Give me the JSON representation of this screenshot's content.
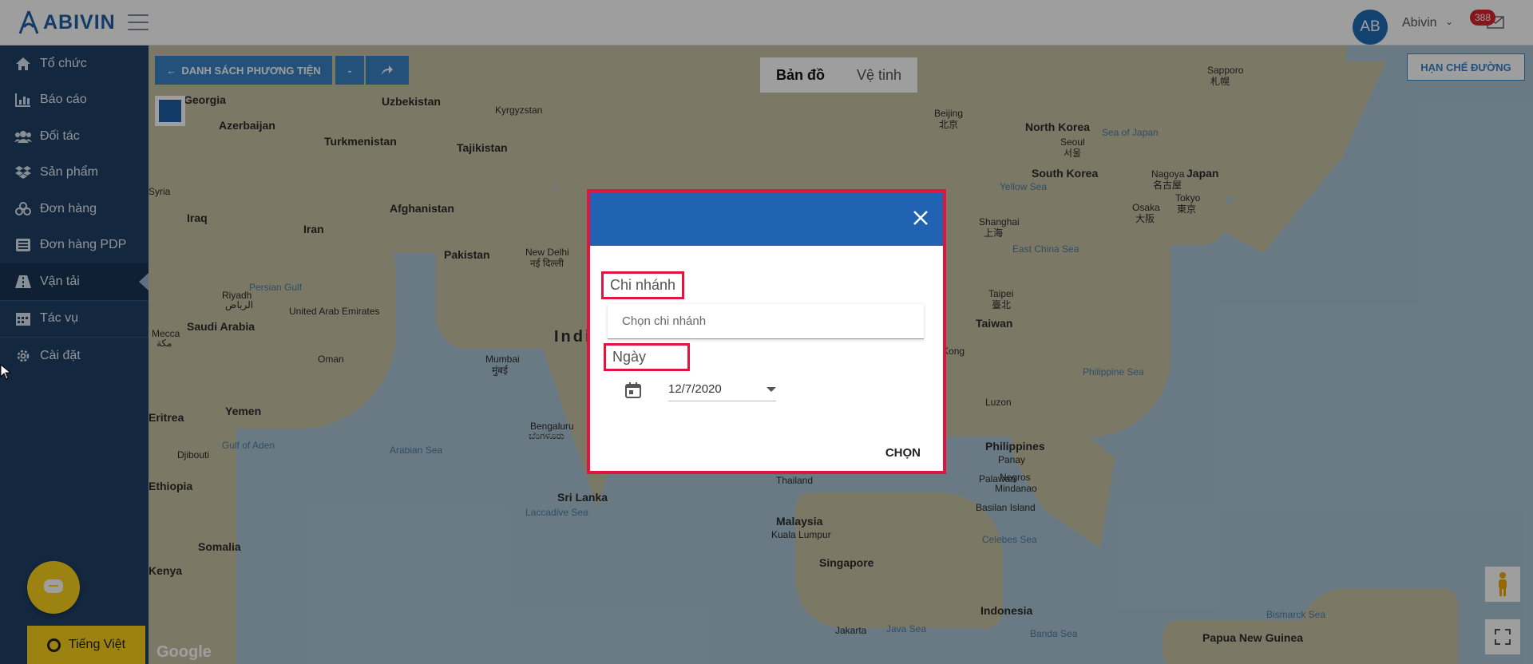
{
  "header": {
    "logo_text": "ABIVIN",
    "avatar_initials": "AB",
    "user_name": "Abivin",
    "notification_count": "388"
  },
  "sidebar": {
    "items": [
      {
        "label": "Tổ chức",
        "icon": "home-icon"
      },
      {
        "label": "Báo cáo",
        "icon": "bar-chart-icon"
      },
      {
        "label": "Đối tác",
        "icon": "users-icon"
      },
      {
        "label": "Sản phẩm",
        "icon": "dropbox-icon"
      },
      {
        "label": "Đơn hàng",
        "icon": "cubes-icon"
      },
      {
        "label": "Đơn hàng PDP",
        "icon": "list-icon"
      },
      {
        "label": "Vận tải",
        "icon": "road-icon",
        "active": true
      },
      {
        "label": "Tác vụ",
        "icon": "calendar-icon"
      },
      {
        "label": "Cài đặt",
        "icon": "gear-icon"
      }
    ],
    "language_label": "Tiếng Việt"
  },
  "map_controls": {
    "vehicle_list_label": "DANH SÁCH PHƯƠNG TIỆN",
    "minus_label": "-",
    "map_tab": "Bản đồ",
    "satellite_tab": "Vệ tinh",
    "restrict_roads_label": "HẠN CHẾ ĐƯỜNG",
    "google_label": "Google"
  },
  "map_labels": [
    "Georgia",
    "Uzbekistan",
    "Kyrgyzstan",
    "Azerbaijan",
    "Turkmenistan",
    "Tajikistan",
    "Syria",
    "Iraq",
    "Afghanistan",
    "Iran",
    "Pakistan",
    "New Delhi",
    "नई दिल्ली",
    "Persian Gulf",
    "Riyadh",
    "الرياض",
    "Saudi Arabia",
    "United Arab Emirates",
    "Mecca",
    "مكة",
    "Oman",
    "Mumbai",
    "मुंबई",
    "India",
    "Yemen",
    "Gulf of Aden",
    "Arabian Sea",
    "Djibouti",
    "Eritrea",
    "Ethiopia",
    "Somalia",
    "Kenya",
    "Bengaluru",
    "ಬೆಂಗಳೂರು",
    "Sri Lanka",
    "Laccadive Sea",
    "Beijing",
    "北京",
    "North Korea",
    "Sea of Japan",
    "Seoul",
    "서울",
    "South Korea",
    "Yellow Sea",
    "Nagoya",
    "名古屋",
    "Japan",
    "Osaka",
    "大阪",
    "Tokyo",
    "東京",
    "Sapporo",
    "札幌",
    "Shanghai",
    "上海",
    "East China Sea",
    "Taipei",
    "臺北",
    "Taiwan",
    "Hong Kong",
    "Philippine Sea",
    "Luzon",
    "Philippines",
    "Panay",
    "Palawan",
    "Negros",
    "Mindanao",
    "Basilan Island",
    "Celebes Sea",
    "Malaysia",
    "Kuala Lumpur",
    "Singapore",
    "Indonesia",
    "Jakarta",
    "Java Sea",
    "Banda Sea",
    "Bismarck Sea",
    "Papua New Guinea",
    "Thailand"
  ],
  "dialog": {
    "branch_label": "Chi nhánh",
    "branch_placeholder": "Chọn chi nhánh",
    "date_label": "Ngày",
    "date_value": "12/7/2020",
    "submit_label": "CHỌN"
  },
  "colors": {
    "sidebar_bg": "#1f3f66",
    "brand_blue": "#1f63b2",
    "highlight_red": "#e0143c",
    "accent_yellow": "#fcd21b"
  }
}
